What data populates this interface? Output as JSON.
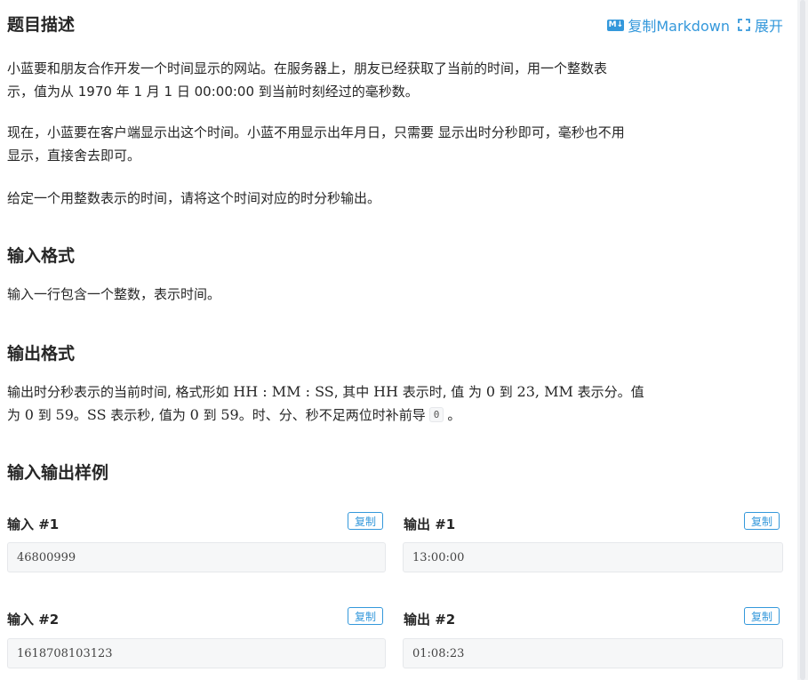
{
  "header": {
    "title": "题目描述",
    "copy_markdown": "复制Markdown",
    "md_badge": "M↓",
    "expand": "展开"
  },
  "description": {
    "p1_line1": "小蓝要和朋友合作开发一个时间显示的网站。在服务器上，朋友已经获取了当前的时间，用一个整数表",
    "p1_line2": "示，值为从 1970 年 1 月 1 日 00:00:00 到当前时刻经过的毫秒数。",
    "p2_line1": "现在，小蓝要在客户端显示出这个时间。小蓝不用显示出年月日，只需要 显示出时分秒即可，毫秒也不用",
    "p2_line2": "显示，直接舍去即可。",
    "p3": "给定一个用整数表示的时间，请将这个时间对应的时分秒输出。"
  },
  "input_format": {
    "title": "输入格式",
    "text": "输入一行包含一个整数，表示时间。"
  },
  "output_format": {
    "title": "输出格式",
    "l1_a": "输出时分秒表示的当前时间, 格式形如 ",
    "l1_math1": "HH : MM : SS",
    "l1_b": ", 其中 ",
    "l1_math2": "HH",
    "l1_c": " 表示时, 值 为 ",
    "l1_math3": "0",
    "l1_d": " 到 ",
    "l1_math4": "23, MM",
    "l1_e": " 表示分。值",
    "l2_a": "为 ",
    "l2_math1": "0",
    "l2_b": " 到 ",
    "l2_math2": "59",
    "l2_c": "。",
    "l2_math3": "SS",
    "l2_d": " 表示秒, 值为 ",
    "l2_math4": "0",
    "l2_e": " 到 ",
    "l2_math5": "59",
    "l2_f": "。时、分、秒不足两位时补前导",
    "l2_code": "0",
    "l2_g": "。"
  },
  "samples": {
    "title": "输入输出样例",
    "copy_label": "复制",
    "items": [
      {
        "input_label": "输入 #1",
        "input": "46800999",
        "output_label": "输出 #1",
        "output": "13:00:00"
      },
      {
        "input_label": "输入 #2",
        "input": "1618708103123",
        "output_label": "输出 #2",
        "output": "01:08:23"
      }
    ]
  },
  "colors": {
    "accent": "#3498db",
    "code_bg": "#f6f7f8",
    "text": "#262626"
  }
}
